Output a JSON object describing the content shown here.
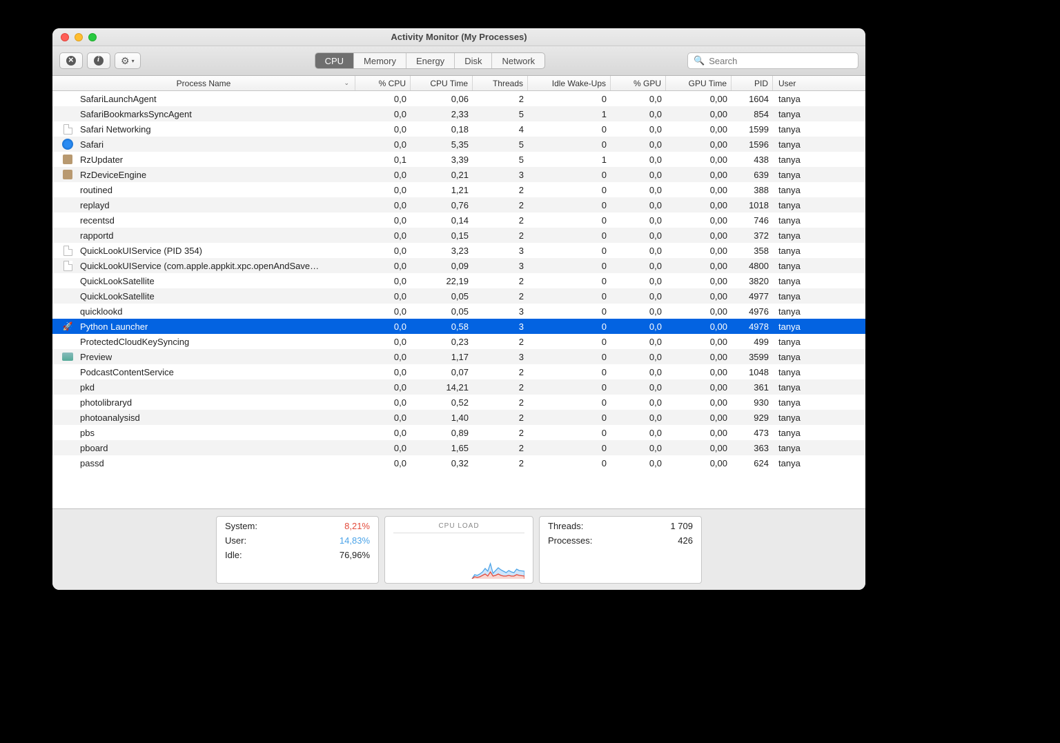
{
  "window_title": "Activity Monitor (My Processes)",
  "toolbar": {
    "tabs": [
      "CPU",
      "Memory",
      "Energy",
      "Disk",
      "Network"
    ],
    "active_tab": 0,
    "search_placeholder": "Search"
  },
  "columns": {
    "process_name": "Process Name",
    "pct_cpu": "% CPU",
    "cpu_time": "CPU Time",
    "threads": "Threads",
    "idle_wake": "Idle Wake-Ups",
    "pct_gpu": "% GPU",
    "gpu_time": "GPU Time",
    "pid": "PID",
    "user": "User"
  },
  "chart_data": {
    "type": "area",
    "title": "CPU LOAD",
    "series": [
      {
        "name": "user",
        "color": "#4aa3e8",
        "values": [
          8,
          7,
          9,
          11,
          16,
          15,
          22,
          12,
          14,
          18,
          16,
          14,
          12,
          15,
          14,
          13,
          17,
          15
        ]
      },
      {
        "name": "system",
        "color": "#e34a3a",
        "values": [
          4,
          3,
          4,
          5,
          7,
          6,
          9,
          5,
          6,
          7,
          6,
          5,
          5,
          6,
          6,
          5,
          7,
          6
        ]
      }
    ],
    "ylim": [
      0,
      100
    ]
  },
  "footer": {
    "left": {
      "system_label": "System:",
      "system_value": "8,21%",
      "user_label": "User:",
      "user_value": "14,83%",
      "idle_label": "Idle:",
      "idle_value": "76,96%"
    },
    "middle_label": "CPU LOAD",
    "right": {
      "threads_label": "Threads:",
      "threads_value": "1 709",
      "processes_label": "Processes:",
      "processes_value": "426"
    }
  },
  "rows": [
    {
      "icon": "none",
      "name": "SafariLaunchAgent",
      "pct_cpu": "0,0",
      "cpu_time": "0,06",
      "threads": "2",
      "wake": "0",
      "pct_gpu": "0,0",
      "gpu_time": "0,00",
      "pid": "1604",
      "user": "tanya"
    },
    {
      "icon": "none",
      "name": "SafariBookmarksSyncAgent",
      "pct_cpu": "0,0",
      "cpu_time": "2,33",
      "threads": "5",
      "wake": "1",
      "pct_gpu": "0,0",
      "gpu_time": "0,00",
      "pid": "854",
      "user": "tanya"
    },
    {
      "icon": "file",
      "name": "Safari Networking",
      "pct_cpu": "0,0",
      "cpu_time": "0,18",
      "threads": "4",
      "wake": "0",
      "pct_gpu": "0,0",
      "gpu_time": "0,00",
      "pid": "1599",
      "user": "tanya"
    },
    {
      "icon": "safari",
      "name": "Safari",
      "pct_cpu": "0,0",
      "cpu_time": "5,35",
      "threads": "5",
      "wake": "0",
      "pct_gpu": "0,0",
      "gpu_time": "0,00",
      "pid": "1596",
      "user": "tanya"
    },
    {
      "icon": "generic",
      "name": "RzUpdater",
      "pct_cpu": "0,1",
      "cpu_time": "3,39",
      "threads": "5",
      "wake": "1",
      "pct_gpu": "0,0",
      "gpu_time": "0,00",
      "pid": "438",
      "user": "tanya"
    },
    {
      "icon": "generic",
      "name": "RzDeviceEngine",
      "pct_cpu": "0,0",
      "cpu_time": "0,21",
      "threads": "3",
      "wake": "0",
      "pct_gpu": "0,0",
      "gpu_time": "0,00",
      "pid": "639",
      "user": "tanya"
    },
    {
      "icon": "none",
      "name": "routined",
      "pct_cpu": "0,0",
      "cpu_time": "1,21",
      "threads": "2",
      "wake": "0",
      "pct_gpu": "0,0",
      "gpu_time": "0,00",
      "pid": "388",
      "user": "tanya"
    },
    {
      "icon": "none",
      "name": "replayd",
      "pct_cpu": "0,0",
      "cpu_time": "0,76",
      "threads": "2",
      "wake": "0",
      "pct_gpu": "0,0",
      "gpu_time": "0,00",
      "pid": "1018",
      "user": "tanya"
    },
    {
      "icon": "none",
      "name": "recentsd",
      "pct_cpu": "0,0",
      "cpu_time": "0,14",
      "threads": "2",
      "wake": "0",
      "pct_gpu": "0,0",
      "gpu_time": "0,00",
      "pid": "746",
      "user": "tanya"
    },
    {
      "icon": "none",
      "name": "rapportd",
      "pct_cpu": "0,0",
      "cpu_time": "0,15",
      "threads": "2",
      "wake": "0",
      "pct_gpu": "0,0",
      "gpu_time": "0,00",
      "pid": "372",
      "user": "tanya"
    },
    {
      "icon": "file",
      "name": "QuickLookUIService (PID 354)",
      "pct_cpu": "0,0",
      "cpu_time": "3,23",
      "threads": "3",
      "wake": "0",
      "pct_gpu": "0,0",
      "gpu_time": "0,00",
      "pid": "358",
      "user": "tanya"
    },
    {
      "icon": "file",
      "name": "QuickLookUIService (com.apple.appkit.xpc.openAndSave…",
      "pct_cpu": "0,0",
      "cpu_time": "0,09",
      "threads": "3",
      "wake": "0",
      "pct_gpu": "0,0",
      "gpu_time": "0,00",
      "pid": "4800",
      "user": "tanya"
    },
    {
      "icon": "none",
      "name": "QuickLookSatellite",
      "pct_cpu": "0,0",
      "cpu_time": "22,19",
      "threads": "2",
      "wake": "0",
      "pct_gpu": "0,0",
      "gpu_time": "0,00",
      "pid": "3820",
      "user": "tanya"
    },
    {
      "icon": "none",
      "name": "QuickLookSatellite",
      "pct_cpu": "0,0",
      "cpu_time": "0,05",
      "threads": "2",
      "wake": "0",
      "pct_gpu": "0,0",
      "gpu_time": "0,00",
      "pid": "4977",
      "user": "tanya"
    },
    {
      "icon": "none",
      "name": "quicklookd",
      "pct_cpu": "0,0",
      "cpu_time": "0,05",
      "threads": "3",
      "wake": "0",
      "pct_gpu": "0,0",
      "gpu_time": "0,00",
      "pid": "4976",
      "user": "tanya"
    },
    {
      "icon": "py",
      "name": "Python Launcher",
      "pct_cpu": "0,0",
      "cpu_time": "0,58",
      "threads": "3",
      "wake": "0",
      "pct_gpu": "0,0",
      "gpu_time": "0,00",
      "pid": "4978",
      "user": "tanya",
      "selected": true
    },
    {
      "icon": "none",
      "name": "ProtectedCloudKeySyncing",
      "pct_cpu": "0,0",
      "cpu_time": "0,23",
      "threads": "2",
      "wake": "0",
      "pct_gpu": "0,0",
      "gpu_time": "0,00",
      "pid": "499",
      "user": "tanya"
    },
    {
      "icon": "preview",
      "name": "Preview",
      "pct_cpu": "0,0",
      "cpu_time": "1,17",
      "threads": "3",
      "wake": "0",
      "pct_gpu": "0,0",
      "gpu_time": "0,00",
      "pid": "3599",
      "user": "tanya"
    },
    {
      "icon": "none",
      "name": "PodcastContentService",
      "pct_cpu": "0,0",
      "cpu_time": "0,07",
      "threads": "2",
      "wake": "0",
      "pct_gpu": "0,0",
      "gpu_time": "0,00",
      "pid": "1048",
      "user": "tanya"
    },
    {
      "icon": "none",
      "name": "pkd",
      "pct_cpu": "0,0",
      "cpu_time": "14,21",
      "threads": "2",
      "wake": "0",
      "pct_gpu": "0,0",
      "gpu_time": "0,00",
      "pid": "361",
      "user": "tanya"
    },
    {
      "icon": "none",
      "name": "photolibraryd",
      "pct_cpu": "0,0",
      "cpu_time": "0,52",
      "threads": "2",
      "wake": "0",
      "pct_gpu": "0,0",
      "gpu_time": "0,00",
      "pid": "930",
      "user": "tanya"
    },
    {
      "icon": "none",
      "name": "photoanalysisd",
      "pct_cpu": "0,0",
      "cpu_time": "1,40",
      "threads": "2",
      "wake": "0",
      "pct_gpu": "0,0",
      "gpu_time": "0,00",
      "pid": "929",
      "user": "tanya"
    },
    {
      "icon": "none",
      "name": "pbs",
      "pct_cpu": "0,0",
      "cpu_time": "0,89",
      "threads": "2",
      "wake": "0",
      "pct_gpu": "0,0",
      "gpu_time": "0,00",
      "pid": "473",
      "user": "tanya"
    },
    {
      "icon": "none",
      "name": "pboard",
      "pct_cpu": "0,0",
      "cpu_time": "1,65",
      "threads": "2",
      "wake": "0",
      "pct_gpu": "0,0",
      "gpu_time": "0,00",
      "pid": "363",
      "user": "tanya"
    },
    {
      "icon": "none",
      "name": "passd",
      "pct_cpu": "0,0",
      "cpu_time": "0,32",
      "threads": "2",
      "wake": "0",
      "pct_gpu": "0,0",
      "gpu_time": "0,00",
      "pid": "624",
      "user": "tanya"
    }
  ]
}
